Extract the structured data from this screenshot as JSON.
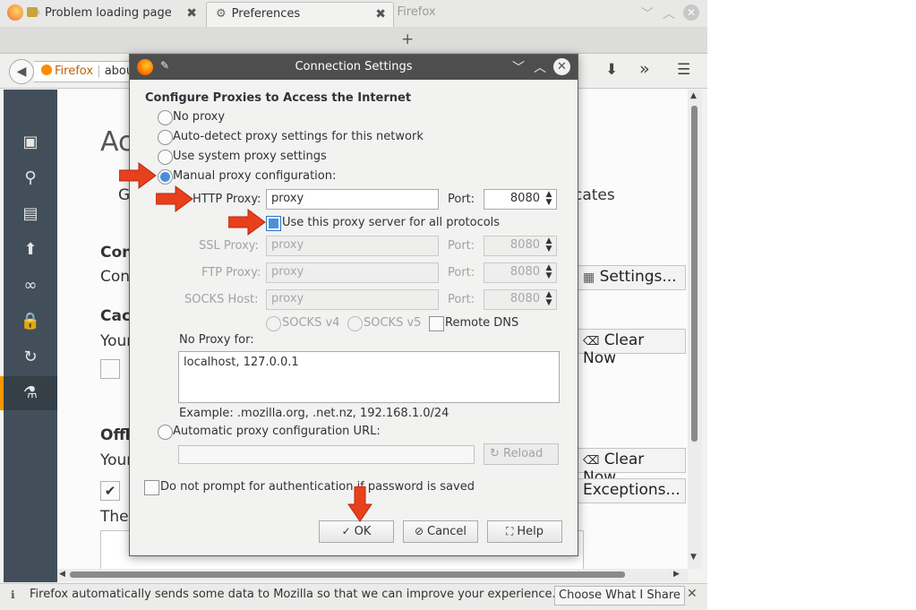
{
  "window": {
    "title": "Preferences – Mozilla Firefox",
    "controls": {
      "minimize": "﹀",
      "maximize": "︿",
      "close": "✕"
    }
  },
  "tabs": [
    {
      "label": "Problem loading page",
      "close": "✖"
    },
    {
      "label": "Preferences",
      "close": "✖"
    }
  ],
  "new_tab": "+",
  "navbar": {
    "back": "◀",
    "url_identity": "Firefox",
    "url_text": "abou",
    "icons": {
      "download": "⬇",
      "overflow": "»",
      "menu": "☰"
    }
  },
  "sidebar_icons": [
    "general-icon",
    "search-icon",
    "content-icon",
    "applications-icon",
    "privacy-icon",
    "security-icon",
    "sync-icon",
    "advanced-icon"
  ],
  "background": {
    "heading": "Ac",
    "tab_g": "G",
    "tab_certificates": "cates",
    "con1": "Con",
    "con2": "Con",
    "cac": "Cac",
    "your1": "Your",
    "offl": "Offl",
    "your2": "Your",
    "the": "The",
    "settings_btn": "Settings...",
    "clear_now_1": "Clear Now",
    "clear_now_2": "Clear Now",
    "exceptions_btn": "Exceptions..."
  },
  "notification": {
    "text": "Firefox automatically sends some data to Mozilla so that we can improve your experience.",
    "button": "Choose What I Share",
    "close": "✕"
  },
  "dialog": {
    "title": "Connection Settings",
    "heading": "Configure Proxies to Access the Internet",
    "options": {
      "no_proxy": "No proxy",
      "auto_detect": "Auto-detect proxy settings for this network",
      "system": "Use system proxy settings",
      "manual": "Manual proxy configuration:",
      "auto_url": "Automatic proxy configuration URL:"
    },
    "http": {
      "label": "HTTP Proxy:",
      "value": "proxy",
      "port_label": "Port:",
      "port": "8080"
    },
    "use_all": "Use this proxy server for all protocols",
    "ssl": {
      "label": "SSL Proxy:",
      "value": "proxy",
      "port_label": "Port:",
      "port": "8080"
    },
    "ftp": {
      "label": "FTP Proxy:",
      "value": "proxy",
      "port_label": "Port:",
      "port": "8080"
    },
    "socks": {
      "label": "SOCKS Host:",
      "value": "proxy",
      "port_label": "Port:",
      "port": "8080"
    },
    "socks_v4": "SOCKS v4",
    "socks_v5": "SOCKS v5",
    "remote_dns": "Remote DNS",
    "no_proxy_for_label": "No Proxy for:",
    "no_proxy_for_value": "localhost, 127.0.0.1",
    "example": "Example: .mozilla.org, .net.nz, 192.168.1.0/24",
    "reload": "Reload",
    "no_prompt": "Do not prompt for authentication if password is saved",
    "buttons": {
      "ok": "OK",
      "cancel": "Cancel",
      "help": "Help"
    }
  },
  "colors": {
    "arrow": "#e8401c",
    "radio_selected": "#4a90d9",
    "sidebar": "#424f5a",
    "accent": "#ff9500"
  }
}
